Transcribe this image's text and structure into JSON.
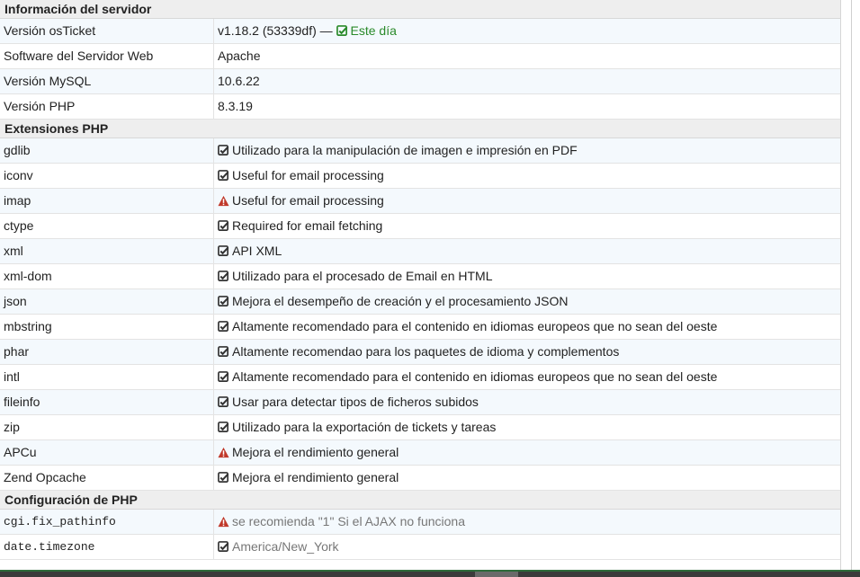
{
  "sections": {
    "server": {
      "title": "Información del servidor",
      "rows": [
        {
          "label": "Versión osTicket",
          "value": "v1.18.2 (53339df) —",
          "status": "Este día"
        },
        {
          "label": "Software del Servidor Web",
          "value": "Apache"
        },
        {
          "label": "Versión MySQL",
          "value": "10.6.22"
        },
        {
          "label": "Versión PHP",
          "value": "8.3.19"
        }
      ]
    },
    "extensions": {
      "title": "Extensiones PHP",
      "rows": [
        {
          "label": "gdlib",
          "value": "Utilizado para la manipulación de imagen e impresión en PDF"
        },
        {
          "label": "iconv",
          "value": "Useful for email processing"
        },
        {
          "label": "imap",
          "value": "Useful for email processing"
        },
        {
          "label": "ctype",
          "value": "Required for email fetching"
        },
        {
          "label": "xml",
          "value": "API XML"
        },
        {
          "label": "xml-dom",
          "value": "Utilizado para el procesado de Email en HTML"
        },
        {
          "label": "json",
          "value": "Mejora el desempeño de creación y el procesamiento JSON"
        },
        {
          "label": "mbstring",
          "value": "Altamente recomendado para el contenido en idiomas europeos que no sean del oeste"
        },
        {
          "label": "phar",
          "value": "Altamente recomendao para los paquetes de idioma y complementos"
        },
        {
          "label": "intl",
          "value": "Altamente recomendado para el contenido en idiomas europeos que no sean del oeste"
        },
        {
          "label": "fileinfo",
          "value": "Usar para detectar tipos de ficheros subidos"
        },
        {
          "label": "zip",
          "value": "Utilizado para la exportación de tickets y tareas"
        },
        {
          "label": "APCu",
          "value": "Mejora el rendimiento general"
        },
        {
          "label": "Zend Opcache",
          "value": "Mejora el rendimiento general"
        }
      ]
    },
    "php_config": {
      "title": "Configuración de PHP",
      "rows": [
        {
          "label": "cgi.fix_pathinfo",
          "value": "se recomienda \"1\" Si el AJAX no funciona"
        },
        {
          "label": "date.timezone",
          "value": "America/New_York"
        }
      ]
    }
  },
  "colors": {
    "ok": "#2a8a2a",
    "check": "#333333",
    "warning": "#c0392b",
    "header_bg": "#eeeeee",
    "alt_row": "#f4f9fd"
  },
  "icons": {
    "check": "check-square-icon",
    "warning": "warning-triangle-icon"
  }
}
